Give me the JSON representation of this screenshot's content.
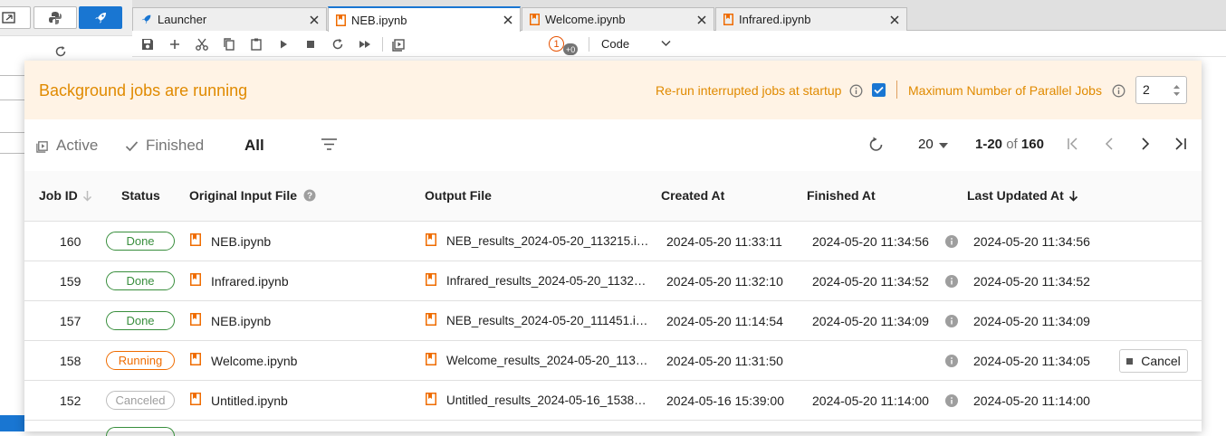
{
  "tabs": [
    {
      "label": "Launcher",
      "icon": "rocket-icon",
      "active": false
    },
    {
      "label": "NEB.ipynb",
      "icon": "notebook-icon",
      "active": true
    },
    {
      "label": "Welcome.ipynb",
      "icon": "notebook-icon",
      "active": false
    },
    {
      "label": "Infrared.ipynb",
      "icon": "notebook-icon",
      "active": false
    }
  ],
  "toolbar": {
    "kernel_count": "1",
    "extra_badge": "+0",
    "cell_type": "Code"
  },
  "banner": {
    "title": "Background jobs are running",
    "rerun_label": "Re-run interrupted jobs at startup",
    "rerun_checked": true,
    "max_jobs_label": "Maximum Number of Parallel Jobs",
    "max_jobs_value": "2"
  },
  "filters": {
    "active": "Active",
    "finished": "Finished",
    "all": "All",
    "selected": "All"
  },
  "pagination": {
    "per_page": "20",
    "range": "1-20",
    "of": "of",
    "total": "160"
  },
  "columns": {
    "job_id": "Job ID",
    "status": "Status",
    "input": "Original Input File",
    "output": "Output File",
    "created": "Created At",
    "finished": "Finished At",
    "updated": "Last Updated At"
  },
  "rows": [
    {
      "id": "160",
      "status": "Done",
      "input": "NEB.ipynb",
      "output": "NEB_results_2024-05-20_113215.i …",
      "created": "2024-05-20 11:33:11",
      "finished": "2024-05-20 11:34:56",
      "updated": "2024-05-20 11:34:56"
    },
    {
      "id": "159",
      "status": "Done",
      "input": "Infrared.ipynb",
      "output": "Infrared_results_2024-05-20_1132 …",
      "created": "2024-05-20 11:32:10",
      "finished": "2024-05-20 11:34:52",
      "updated": "2024-05-20 11:34:52"
    },
    {
      "id": "157",
      "status": "Done",
      "input": "NEB.ipynb",
      "output": "NEB_results_2024-05-20_111451.i …",
      "created": "2024-05-20 11:14:54",
      "finished": "2024-05-20 11:34:09",
      "updated": "2024-05-20 11:34:09"
    },
    {
      "id": "158",
      "status": "Running",
      "input": "Welcome.ipynb",
      "output": "Welcome_results_2024-05-20_113…",
      "created": "2024-05-20 11:31:50",
      "finished": "",
      "updated": "2024-05-20 11:34:05",
      "action": "Cancel"
    },
    {
      "id": "152",
      "status": "Canceled",
      "input": "Untitled.ipynb",
      "output": "Untitled_results_2024-05-16_1538 …",
      "created": "2024-05-16 15:39:00",
      "finished": "2024-05-20 11:14:00",
      "updated": "2024-05-20 11:14:00"
    }
  ],
  "colors": {
    "accent": "#1976d2",
    "warning_text": "#e08a00",
    "banner_bg": "#fff3e5",
    "done": "#388e3c",
    "running": "#ef6c00",
    "canceled": "#9e9e9e"
  }
}
